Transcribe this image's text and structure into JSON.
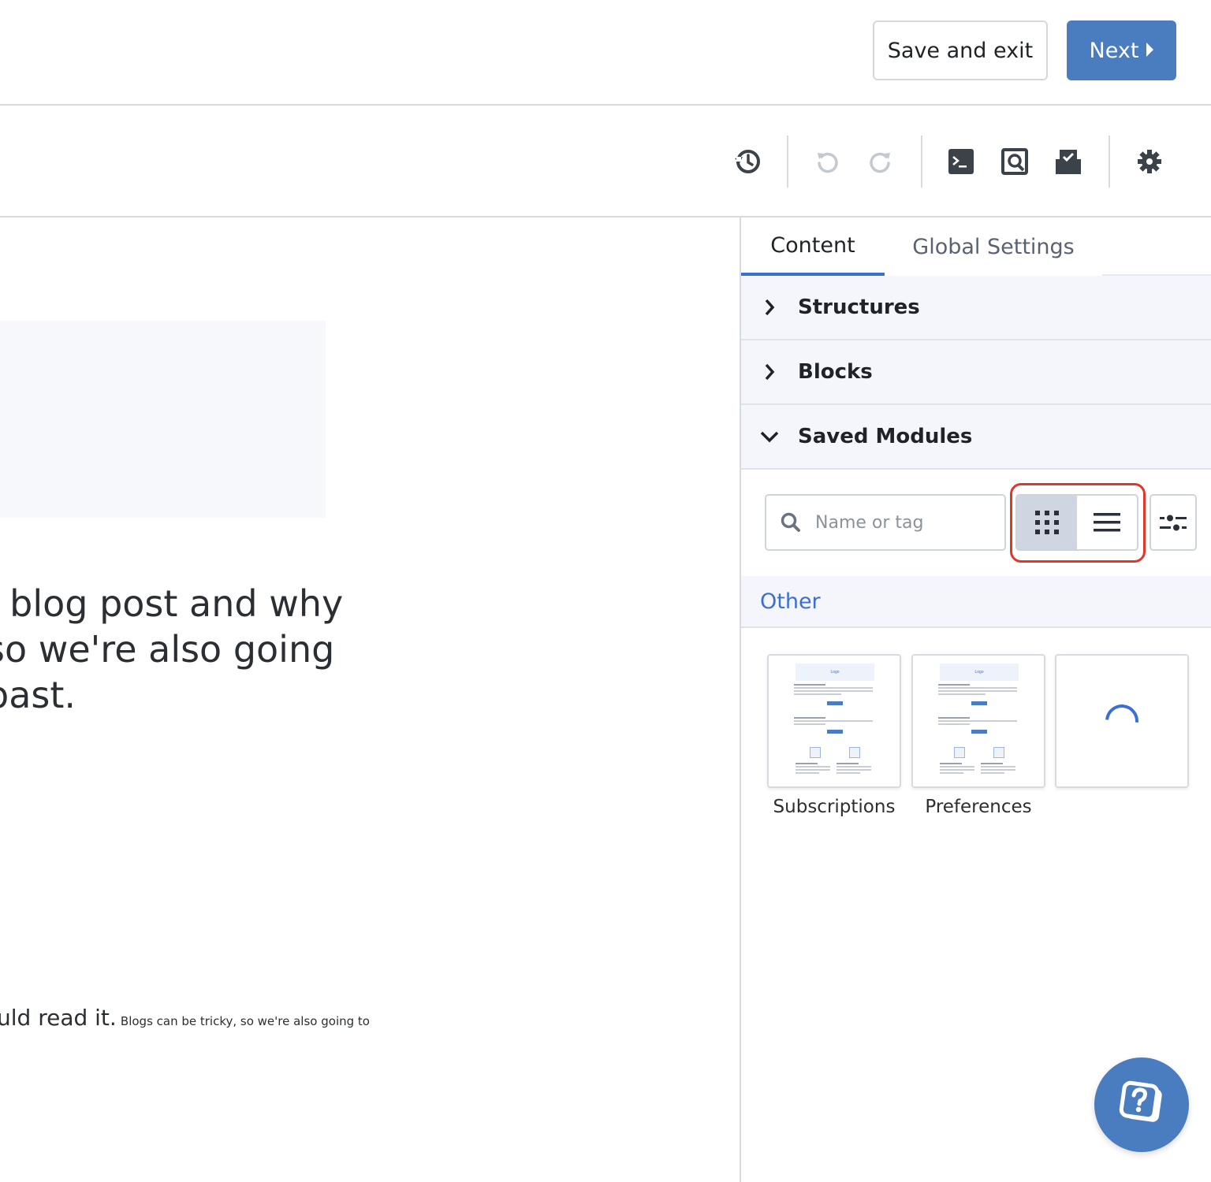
{
  "topbar": {
    "save_exit_label": "Save and exit",
    "next_label": "Next"
  },
  "toolbar": {
    "icons": [
      "history-icon",
      "undo-icon",
      "redo-icon",
      "code-icon",
      "preview-icon",
      "test-icon",
      "settings-icon"
    ]
  },
  "canvas": {
    "heading_lines": "/ blog post and why\nso we're also going\npast.",
    "small_big": "uld read it.",
    "small_text": "Blogs can be tricky, so we're also going to"
  },
  "panel": {
    "tabs": [
      {
        "label": "Content",
        "active": true
      },
      {
        "label": "Global Settings",
        "active": false
      }
    ],
    "sections": [
      {
        "label": "Structures",
        "expanded": false
      },
      {
        "label": "Blocks",
        "expanded": false
      },
      {
        "label": "Saved Modules",
        "expanded": true
      }
    ],
    "search_placeholder": "Name or tag",
    "view_mode": "grid",
    "group_title": "Other",
    "modules": [
      {
        "label": "Subscriptions"
      },
      {
        "label": "Preferences"
      }
    ]
  },
  "colors": {
    "accent": "#4a7cc0",
    "tab_active": "#3b6fd4",
    "highlight": "#e0362b"
  }
}
